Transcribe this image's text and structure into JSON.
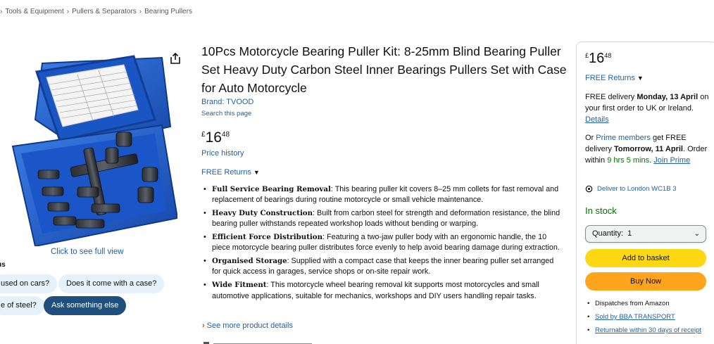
{
  "breadcrumb": {
    "items": [
      "Tools & Equipment",
      "Pullers & Separators",
      "Bearing Pullers"
    ],
    "separator": "›"
  },
  "gallery": {
    "see_full_view": "Click to see full view",
    "share_icon": "share-icon",
    "case_color": "#1f5fc9"
  },
  "rufus": {
    "label": "us",
    "chips": [
      "used on cars?",
      "Does it come with a case?",
      "e of steel?"
    ],
    "ask_button": "Ask something else"
  },
  "product": {
    "title": "10Pcs Motorcycle Bearing Puller Kit: 8-25mm Blind Bearing Puller Set Heavy Duty Carbon Steel Inner Bearings Pullers Set with Case for Auto Motorcycle",
    "brand": "Brand: TVOOD",
    "search_page": "Search this page",
    "price": {
      "currency": "£",
      "whole": "16",
      "fraction": "48"
    },
    "price_history": "Price history",
    "free_returns": "FREE Returns",
    "bullets": [
      {
        "title": "Full Service Bearing Removal",
        "text": ": This bearing puller kit covers 8–25 mm collets for fast removal and replacement of bearings during routine motorcycle or small vehicle maintenance."
      },
      {
        "title": "Heavy Duty Construction",
        "text": ": Built from carbon steel for strength and deformation resistance, the blind bearing puller withstands repeated workshop loads without bending or warping."
      },
      {
        "title": "Efficient Force Distribution",
        "text": ": Featuring a two-jaw puller body with an ergonomic handle, the 10 piece motorcycle bearing puller distributes force evenly to help avoid bearing damage during extraction."
      },
      {
        "title": "Organised Storage",
        "text": ": Supplied with a compact case that keeps the inner bearing puller set arranged for quick access in garages, service shops or on-site repair work."
      },
      {
        "title": "Wide Fitment",
        "text": ": This motorcycle wheel bearing removal kit supports most motorcycles and small automotive applications, suitable for mechanics, workshops and DIY users handling repair tasks."
      }
    ],
    "see_more": "See more product details"
  },
  "buybox": {
    "price": {
      "currency": "£",
      "whole": "16",
      "fraction": "48"
    },
    "free_returns": "FREE Returns",
    "delivery": {
      "prefix": "FREE delivery ",
      "date": "Monday, 13 April",
      "middle": " on your first order to UK or Ireland. ",
      "details_link": "Details"
    },
    "prime": {
      "or": "Or ",
      "prime_members": "Prime members",
      "get_free": " get FREE delivery ",
      "date": "Tomorrow, 11 April",
      "order_within": ". Order within ",
      "countdown": "9 hrs 5 mins",
      "period": ". ",
      "join_prime": "Join Prime"
    },
    "location": "Deliver to London WC1B 3",
    "stock": "In stock",
    "quantity": "Quantity:  1",
    "add_to_basket": "Add to basket",
    "buy_now": "Buy Now",
    "info": {
      "dispatches": "Dispatches from Amazon",
      "sold_by": "Sold by BBA TRANSPORT",
      "returnable": "Returnable within 30 days of receipt"
    },
    "colors": {
      "add_to_basket": "#ffd814",
      "buy_now": "#ffa41c",
      "link": "#2162a1",
      "in_stock": "#007600"
    }
  }
}
